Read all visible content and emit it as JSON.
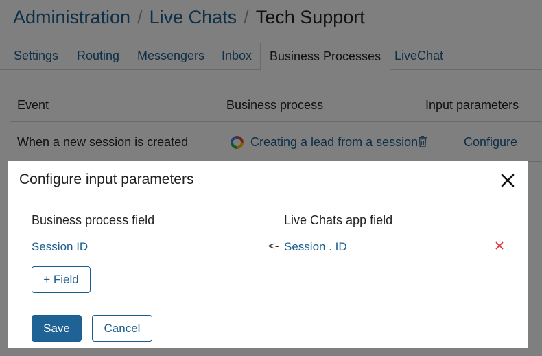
{
  "breadcrumb": {
    "items": [
      "Administration",
      "Live Chats"
    ],
    "current": "Tech Support",
    "separator": "/"
  },
  "tabs": [
    {
      "label": "Settings",
      "active": false
    },
    {
      "label": "Routing",
      "active": false
    },
    {
      "label": "Messengers",
      "active": false
    },
    {
      "label": "Inbox",
      "active": false
    },
    {
      "label": "Business Processes",
      "active": true
    },
    {
      "label": "LiveChat",
      "active": false
    }
  ],
  "table": {
    "headers": {
      "event": "Event",
      "process": "Business process",
      "params": "Input parameters"
    },
    "rows": [
      {
        "event": "When a new session is created",
        "process": "Creating a lead from a session",
        "process_icon": "colored-ring-icon",
        "delete_icon": "trash-icon",
        "action": "Configure"
      }
    ]
  },
  "modal": {
    "title": "Configure input parameters",
    "close_icon": "close-icon",
    "columns": {
      "bp_field": "Business process field",
      "app_field": "Live Chats app field"
    },
    "mapping": [
      {
        "bp_field": "Session ID",
        "arrow": "<-",
        "app_field": "Session . ID",
        "remove_icon": "remove-x-icon"
      }
    ],
    "add_field_label": "+ Field",
    "save_label": "Save",
    "cancel_label": "Cancel"
  },
  "colors": {
    "link": "#1a5e8f",
    "primary": "#1f6296",
    "remove": "#e0303a",
    "overlay": "rgba(0,0,0,0.5)"
  }
}
